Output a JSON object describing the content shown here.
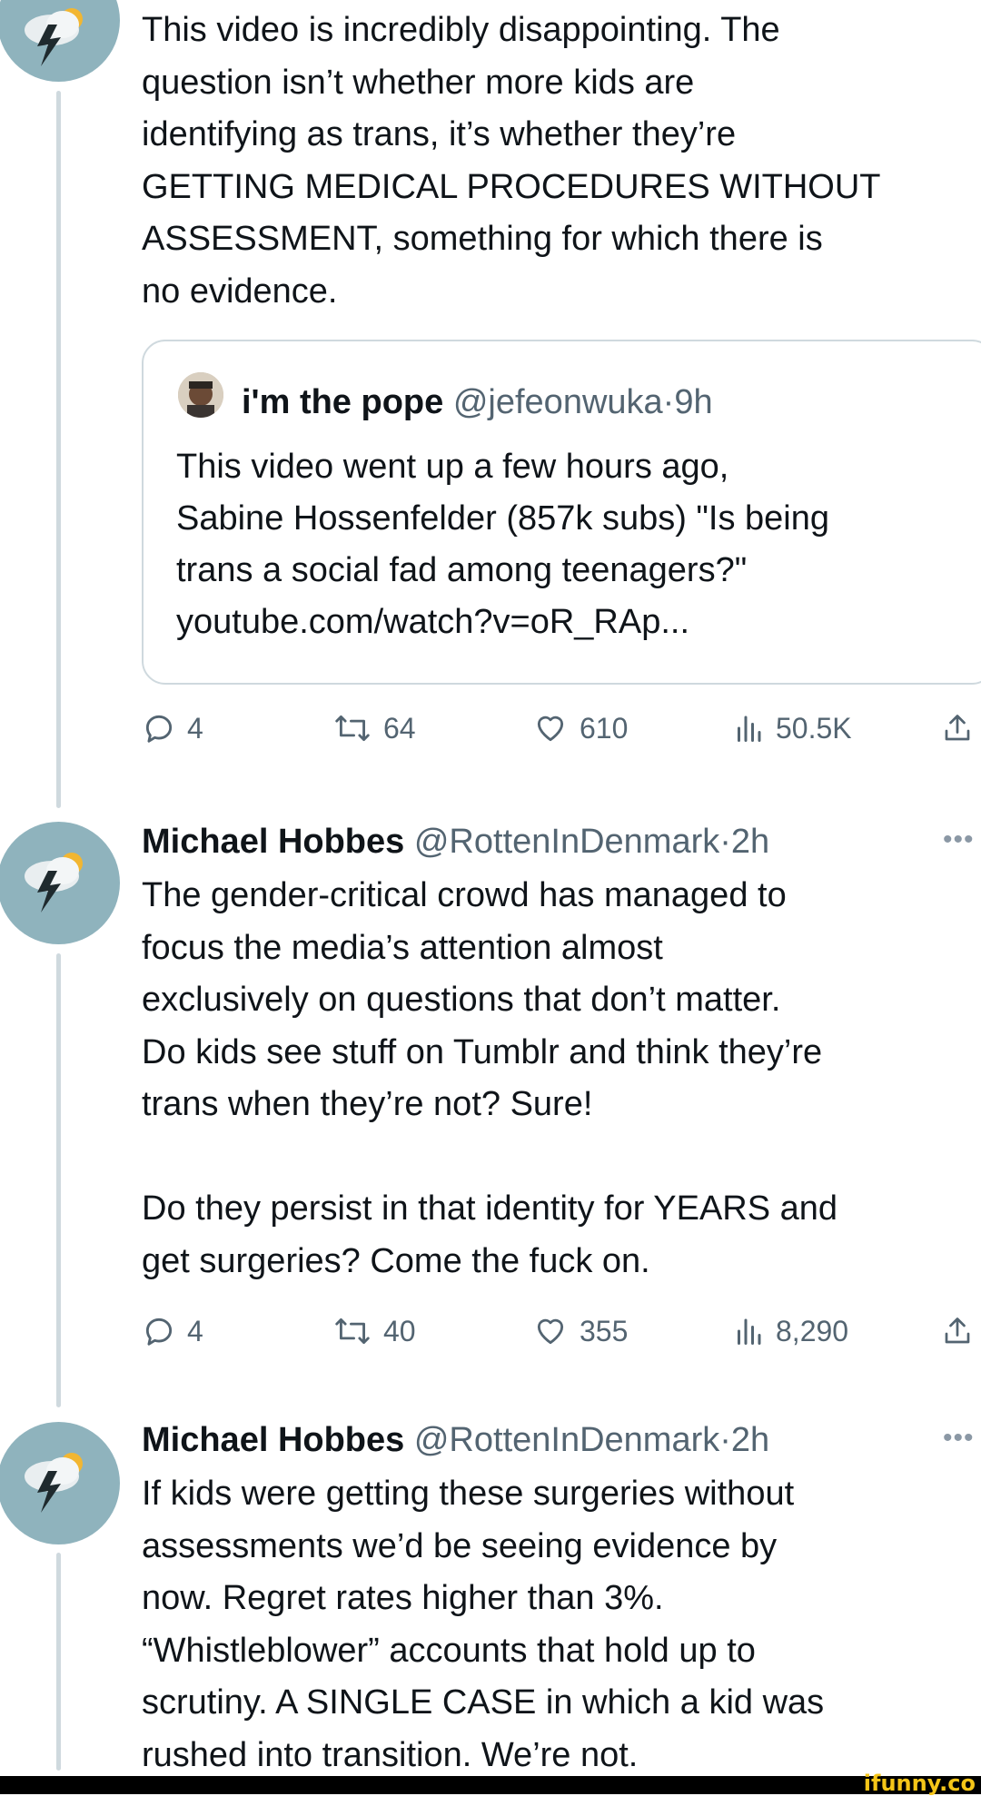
{
  "tweet1": {
    "text": "This video is incredibly disappointing. The\nquestion isn’t whether more kids are\nidentifying as trans, it’s whether they’re\nGETTING MEDICAL PROCEDURES WITHOUT\nASSESSMENT, something for which there is\nno evidence.",
    "quote": {
      "name": "i'm the pope",
      "handle": "@jefeonwuka",
      "dot": "·",
      "time": "9h",
      "text": "This video went up a few hours ago,\nSabine Hossenfelder (857k subs) \"Is being\ntrans a social fad among teenagers?\"\nyoutube.com/watch?v=oR_RAp..."
    },
    "replies": "4",
    "retweets": "64",
    "likes": "610",
    "views": "50.5K"
  },
  "tweet2": {
    "name": "Michael Hobbes",
    "handle": "@RottenInDenmark",
    "dot": "·",
    "time": "2h",
    "more": "•••",
    "text": "The gender-critical crowd has managed to\nfocus the media’s attention almost\nexclusively on questions that don’t matter.\nDo kids see stuff on Tumblr and think they’re\ntrans when they’re not? Sure!\n\nDo they persist in that identity for YEARS and\nget surgeries? Come the fuck on.",
    "replies": "4",
    "retweets": "40",
    "likes": "355",
    "views": "8,290"
  },
  "tweet3": {
    "name": "Michael Hobbes",
    "handle": "@RottenInDenmark",
    "dot": "·",
    "time": "2h",
    "more": "•••",
    "text": "If kids were getting these surgeries without\nassessments we’d be seeing evidence by\nnow. Regret rates higher than 3%.\n“Whistleblower” accounts that hold up to\nscrutiny. A SINGLE CASE in which a kid was\nrushed into transition. We’re not."
  },
  "watermark": "ifunny.co",
  "colors": {
    "text": "#0f1419",
    "secondary": "#536471",
    "thread_line": "#cfd9de",
    "avatar_bg": "#8fb3bd"
  },
  "icons": {
    "avatar": "storm-cloud-lightning-icon",
    "reply": "reply-icon",
    "retweet": "retweet-icon",
    "like": "heart-icon",
    "views": "views-icon",
    "share": "share-icon"
  }
}
